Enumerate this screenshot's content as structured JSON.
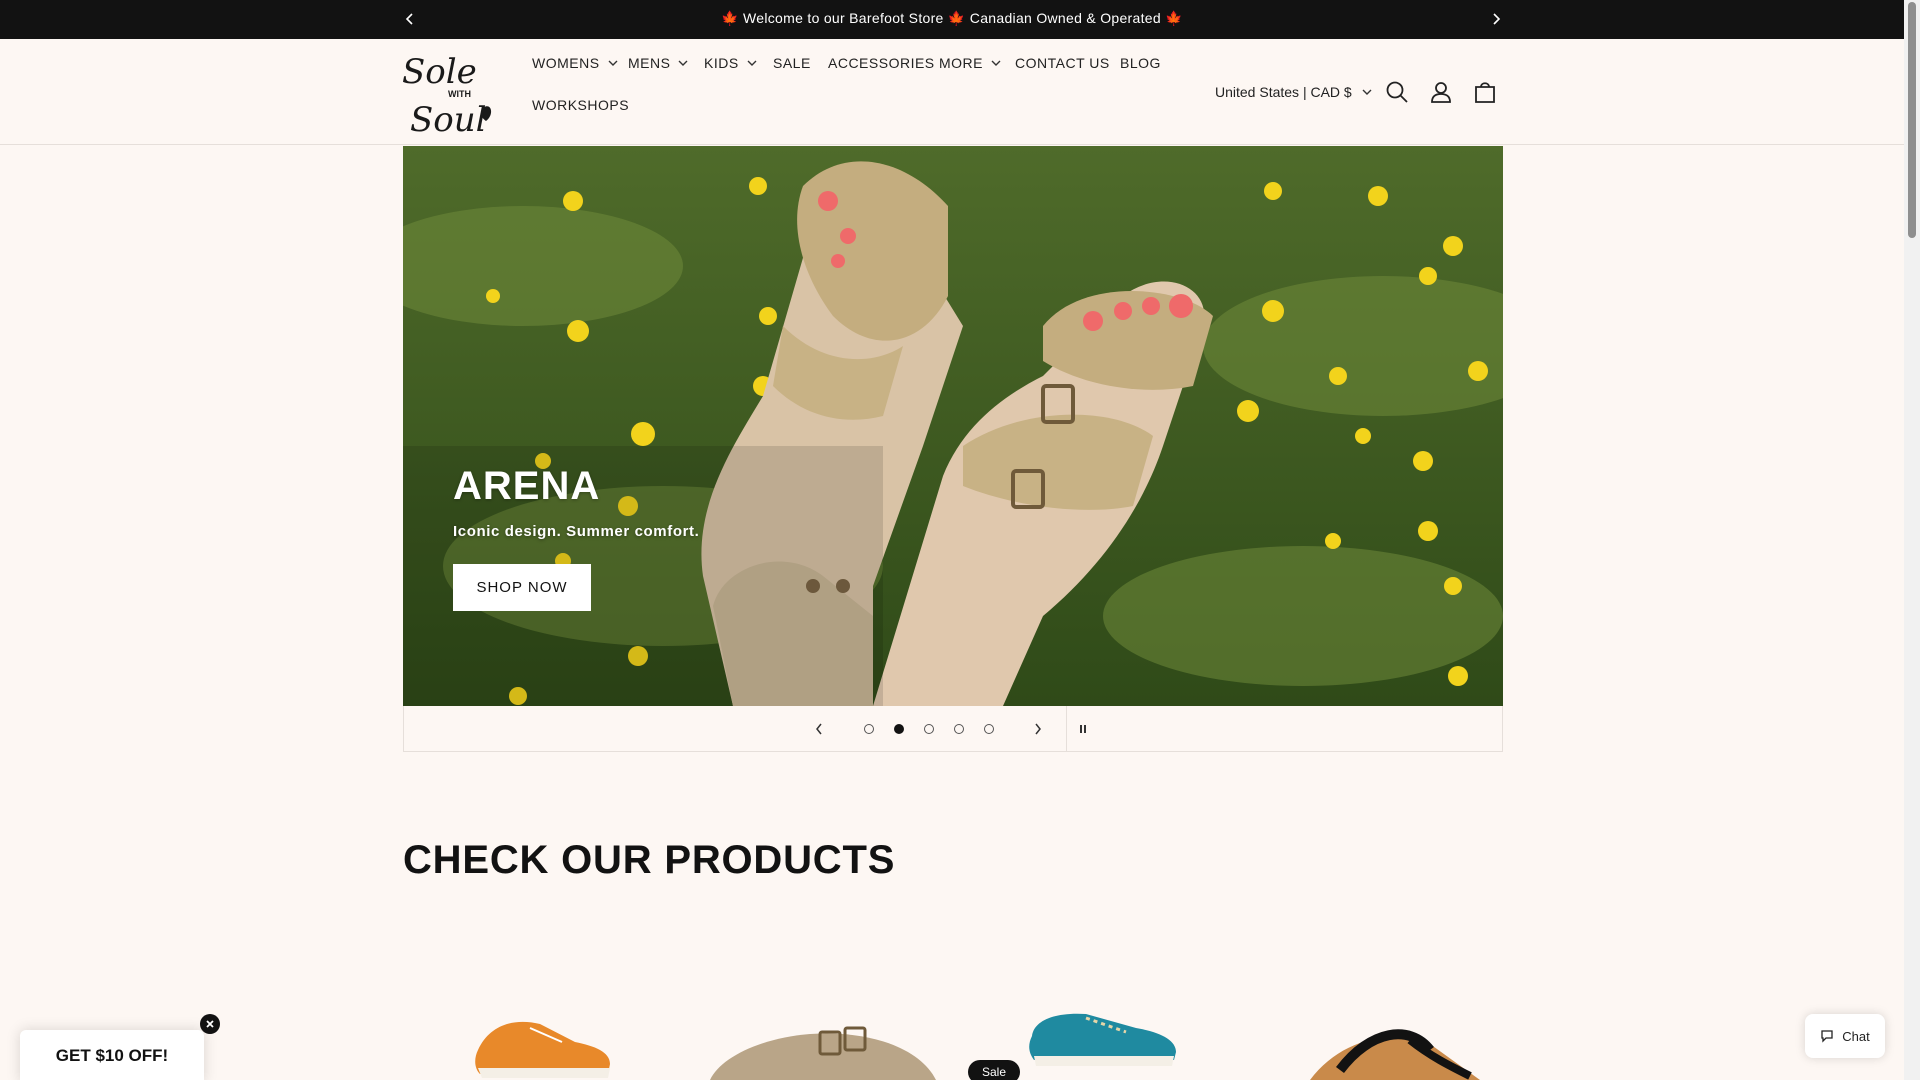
{
  "announcement": {
    "message_part1": "Welcome to our Barefoot Store",
    "message_part2": "Canadian Owned & Operated",
    "maple_icon": "🍁"
  },
  "header": {
    "logo_text_1": "Sole",
    "logo_text_2": "WITH",
    "logo_text_3": "Soul",
    "nav": [
      {
        "label": "WOMENS",
        "has_dropdown": true
      },
      {
        "label": "MENS",
        "has_dropdown": true
      },
      {
        "label": "KIDS",
        "has_dropdown": true
      },
      {
        "label": "SALE",
        "has_dropdown": false
      },
      {
        "label": "ACCESSORIES",
        "has_dropdown": false
      },
      {
        "label": "MORE",
        "has_dropdown": true
      },
      {
        "label": "CONTACT US",
        "has_dropdown": false
      },
      {
        "label": "BLOG",
        "has_dropdown": false
      },
      {
        "label": "WORKSHOPS",
        "has_dropdown": false
      }
    ],
    "country_selector": "United States | CAD $",
    "icons": [
      "search-icon",
      "account-icon",
      "cart-icon"
    ]
  },
  "hero": {
    "title": "ARENA",
    "subtitle": "Iconic design. Summer comfort.",
    "button_label": "SHOP NOW",
    "slide_count": 5,
    "active_slide": 2
  },
  "products": {
    "section_title": "CHECK OUR PRODUCTS",
    "sale_badge": "Sale"
  },
  "promo": {
    "label": "GET $10 OFF!"
  },
  "chat": {
    "label": "Chat"
  },
  "colors": {
    "background": "#fdf7f3",
    "announcement_bg": "#121212",
    "accent_maple": "#e63a1d"
  }
}
